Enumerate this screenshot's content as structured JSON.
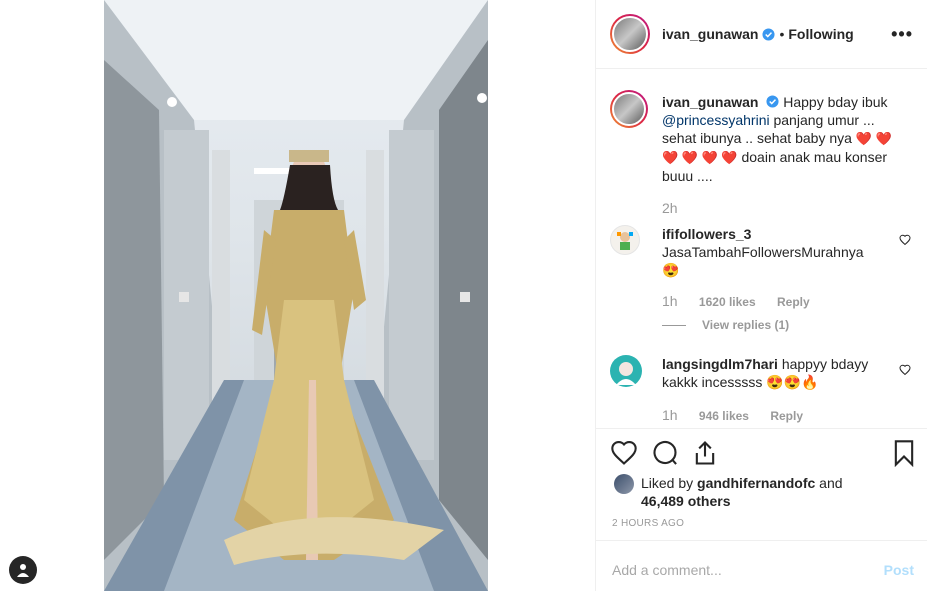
{
  "post": {
    "username": "ivan_gunawan",
    "dot": "•",
    "follow_status": "Following",
    "more_label": "•••"
  },
  "caption": {
    "username": "ivan_gunawan",
    "text_a": "Happy bday ibuk",
    "mention": "@princessyahrini",
    "text_b": "panjang umur ...",
    "text_c": "sehat ibunya .. sehat baby nya",
    "text_d": "doain anak mau konser",
    "text_e": "buuu ....",
    "hearts_line1": "❤️ ❤️",
    "hearts_line2": "❤️ ❤️ ❤️ ❤️",
    "time": "2h"
  },
  "comments": [
    {
      "username": "ififollowers_3",
      "text": "JasaTambahFollowersMurahnya",
      "emoji": "😍",
      "time": "1h",
      "likes": "1620 likes",
      "reply": "Reply",
      "view_replies": "View replies (1)"
    },
    {
      "username": "langsingdlm7hari",
      "text_a": "happyy bdayy",
      "text_b": "kakkk incesssss",
      "emoji": "😍😍🔥",
      "time": "1h",
      "likes": "946 likes",
      "reply": "Reply"
    }
  ],
  "likes": {
    "prefix": "Liked by",
    "user": "gandhifernandofc",
    "and": "and",
    "others": "46,489 others"
  },
  "timestamp": "2 HOURS AGO",
  "comment_input": {
    "placeholder": "Add a comment...",
    "post_label": "Post"
  },
  "colors": {
    "verified": "#3897f0",
    "heart": "#ed4956",
    "post_disabled": "#b2dffc"
  }
}
